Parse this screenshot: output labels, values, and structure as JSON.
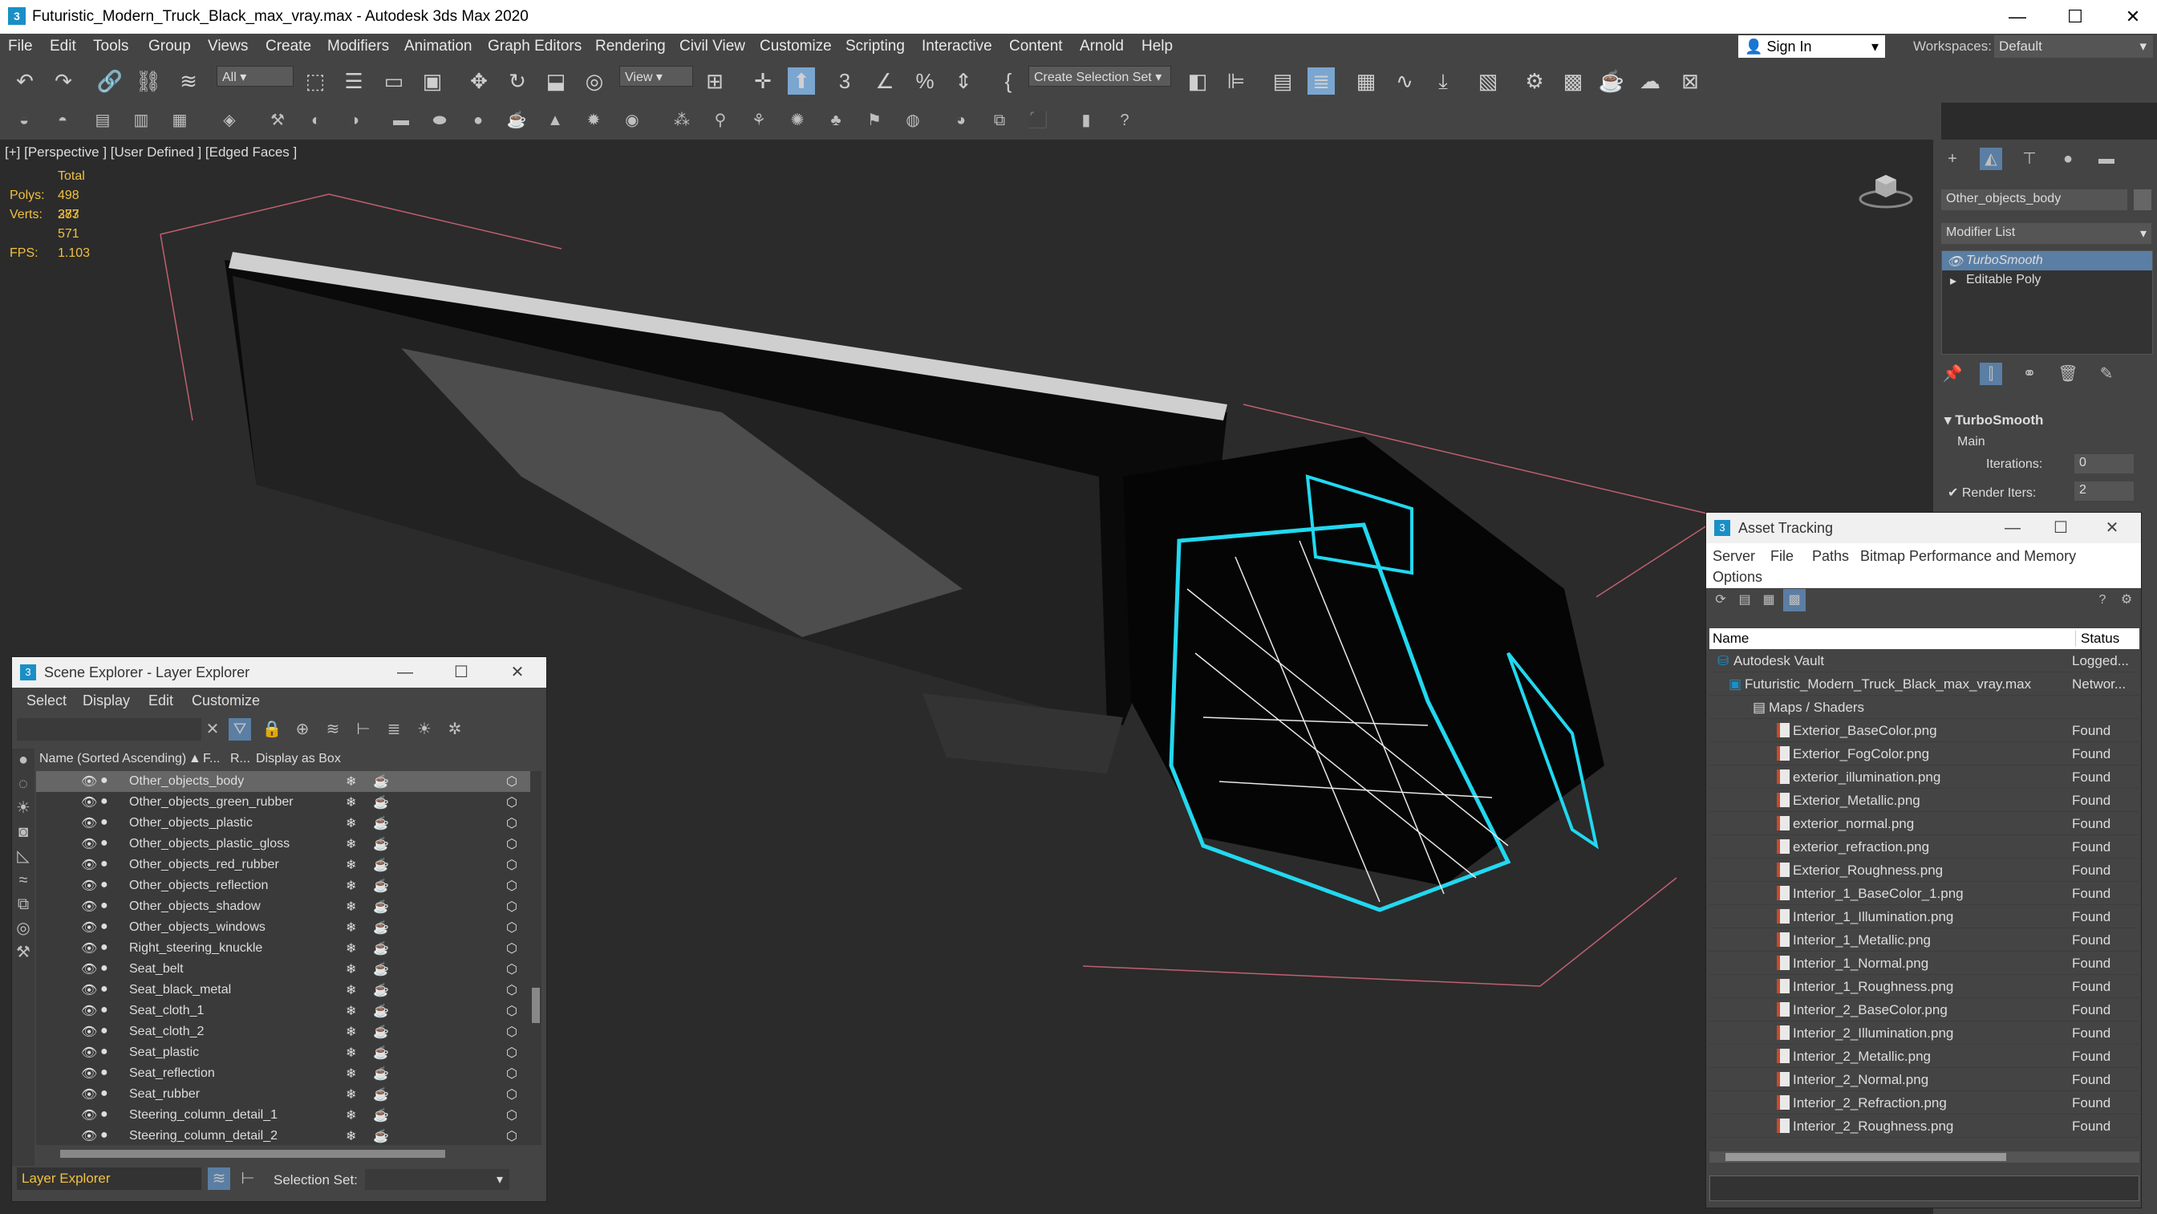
{
  "window": {
    "title": "Futuristic_Modern_Truck_Black_max_vray.max - Autodesk 3ds Max 2020",
    "minimize": "—",
    "maximize": "☐",
    "close": "✕"
  },
  "menu": [
    "File",
    "Edit",
    "Tools",
    "Group",
    "Views",
    "Create",
    "Modifiers",
    "Animation",
    "Graph Editors",
    "Rendering",
    "Civil View",
    "Customize",
    "Scripting",
    "Interactive",
    "Content",
    "Arnold",
    "Help"
  ],
  "signin": "Sign In",
  "workspaces_label": "Workspaces:",
  "workspace_value": "Default",
  "toolbar": {
    "filter": "All",
    "view": "View",
    "selection_set": "Create Selection Set"
  },
  "viewport": {
    "label": "[+] [Perspective ] [User Defined ] [Edged Faces ]",
    "total": "Total",
    "polys_label": "Polys:",
    "polys": "498 373",
    "verts_label": "Verts:",
    "verts": "287 571",
    "fps_label": "FPS:",
    "fps": "1.103"
  },
  "cmd": {
    "object_name": "Other_objects_body",
    "modifier_list": "Modifier List",
    "stack": [
      "TurboSmooth",
      "Editable Poly"
    ],
    "rollout": "TurboSmooth",
    "main": "Main",
    "iterations_label": "Iterations:",
    "iterations": "0",
    "render_iters_label": "Render Iters:",
    "render_iters": "2"
  },
  "scene_explorer": {
    "title": "Scene Explorer - Layer Explorer",
    "menu": [
      "Select",
      "Display",
      "Edit",
      "Customize"
    ],
    "col_name": "Name (Sorted Ascending)",
    "col_f": "F...",
    "col_r": "R...",
    "col_box": "Display as Box",
    "rows": [
      "Other_objects_body",
      "Other_objects_green_rubber",
      "Other_objects_plastic",
      "Other_objects_plastic_gloss",
      "Other_objects_red_rubber",
      "Other_objects_reflection",
      "Other_objects_shadow",
      "Other_objects_windows",
      "Right_steering_knuckle",
      "Seat_belt",
      "Seat_black_metal",
      "Seat_cloth_1",
      "Seat_cloth_2",
      "Seat_plastic",
      "Seat_reflection",
      "Seat_rubber",
      "Steering_column_detail_1",
      "Steering_column_detail_2"
    ],
    "footer_explorer": "Layer Explorer",
    "footer_selset": "Selection Set:"
  },
  "asset_tracking": {
    "title": "Asset Tracking",
    "menu": [
      "Server",
      "File",
      "Paths",
      "Bitmap Performance and Memory",
      "Options"
    ],
    "col_name": "Name",
    "col_status": "Status",
    "rows": [
      {
        "name": "Autodesk Vault",
        "status": "Logged..."
      },
      {
        "name": "Futuristic_Modern_Truck_Black_max_vray.max",
        "status": "Networ..."
      },
      {
        "name": "Maps / Shaders",
        "status": ""
      },
      {
        "name": "Exterior_BaseColor.png",
        "status": "Found"
      },
      {
        "name": "Exterior_FogColor.png",
        "status": "Found"
      },
      {
        "name": "exterior_illumination.png",
        "status": "Found"
      },
      {
        "name": "Exterior_Metallic.png",
        "status": "Found"
      },
      {
        "name": "exterior_normal.png",
        "status": "Found"
      },
      {
        "name": "exterior_refraction.png",
        "status": "Found"
      },
      {
        "name": "Exterior_Roughness.png",
        "status": "Found"
      },
      {
        "name": "Interior_1_BaseColor_1.png",
        "status": "Found"
      },
      {
        "name": "Interior_1_Illumination.png",
        "status": "Found"
      },
      {
        "name": "Interior_1_Metallic.png",
        "status": "Found"
      },
      {
        "name": "Interior_1_Normal.png",
        "status": "Found"
      },
      {
        "name": "Interior_1_Roughness.png",
        "status": "Found"
      },
      {
        "name": "Interior_2_BaseColor.png",
        "status": "Found"
      },
      {
        "name": "Interior_2_Illumination.png",
        "status": "Found"
      },
      {
        "name": "Interior_2_Metallic.png",
        "status": "Found"
      },
      {
        "name": "Interior_2_Normal.png",
        "status": "Found"
      },
      {
        "name": "Interior_2_Refraction.png",
        "status": "Found"
      },
      {
        "name": "Interior_2_Roughness.png",
        "status": "Found"
      }
    ]
  }
}
